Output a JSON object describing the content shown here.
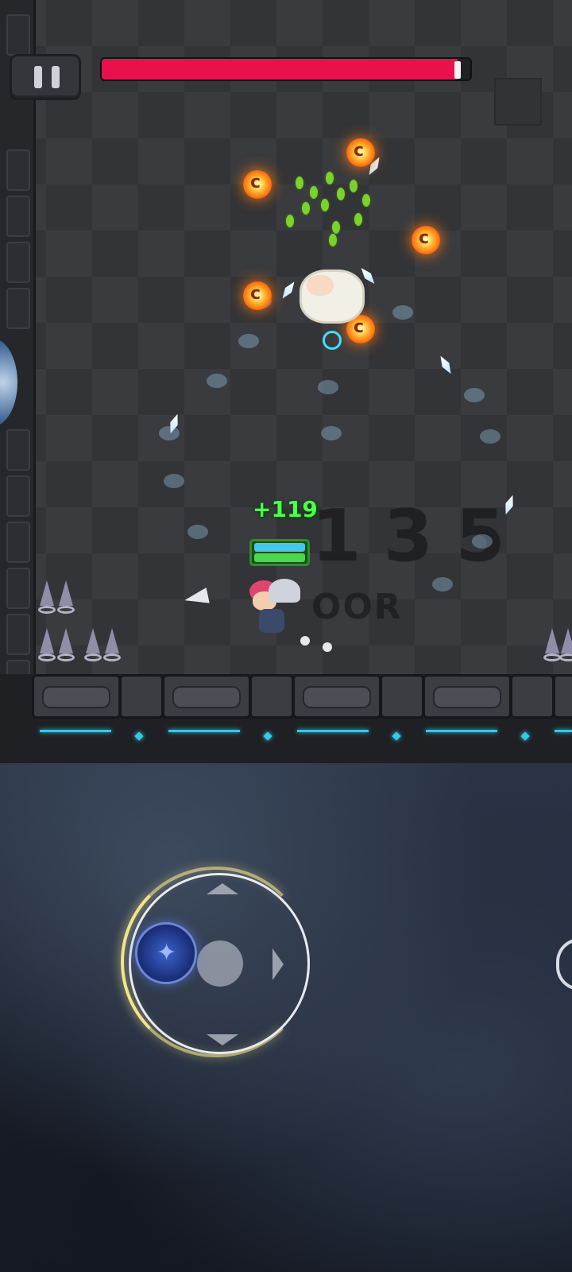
{
  "hud": {
    "pause_icon": "pause-icon",
    "boss_health_percent": 0.965,
    "boss_bar_color": "#e8114c"
  },
  "floor": {
    "number": "135",
    "label": "OOR"
  },
  "player": {
    "heal_text": "+119",
    "hp_bar_color": "#4dd64d",
    "shield_bar_color": "#46c8e6"
  },
  "controls": {
    "joystick_icon": "joystick-icon",
    "skill_icon": "star-icon",
    "accent_color": "#f3e48a"
  }
}
